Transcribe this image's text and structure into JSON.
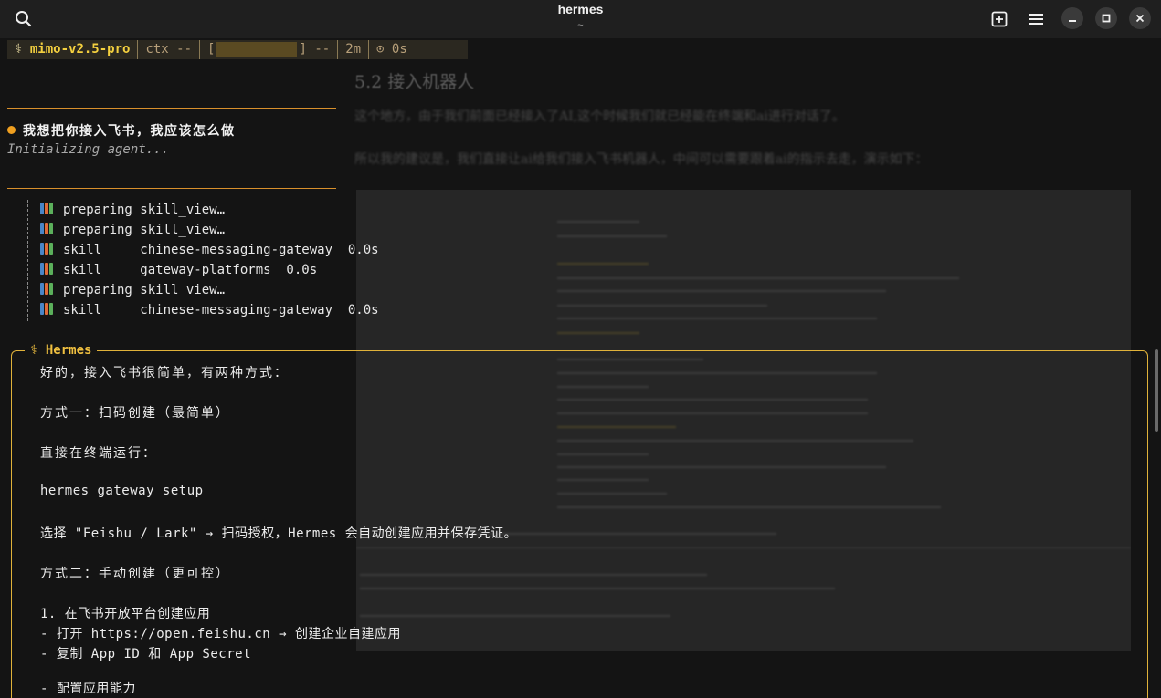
{
  "window": {
    "title": "hermes",
    "subtitle": "~"
  },
  "status": {
    "model_icon": "⚕",
    "model": "mimo-v2.5-pro",
    "ctx": "ctx --",
    "bar_open": "[",
    "bar_close": "] --",
    "time": "2m",
    "timer_icon": "⊙",
    "elapsed": "0s"
  },
  "background_document": {
    "heading": "5.2 接入机器人",
    "paragraph_1": "这个地方，由于我们前面已经接入了AI,这个时候我们就已经能在终端和ai进行对话了。",
    "paragraph_2": "所以我的建议是，我们直接让ai给我们接入飞书机器人，中间可以需要跟着ai的指示去走，演示如下："
  },
  "conversation": {
    "user_message": "我想把你接入飞书，我应该怎么做",
    "status_text": "Initializing agent...",
    "tool_calls": [
      {
        "icon": "book-icon",
        "text": "preparing skill_view…"
      },
      {
        "icon": "book-icon",
        "text": "preparing skill_view…"
      },
      {
        "icon": "book-icon",
        "text": "skill     chinese-messaging-gateway  0.0s"
      },
      {
        "icon": "book-icon",
        "text": "skill     gateway-platforms  0.0s"
      },
      {
        "icon": "book-icon",
        "text": "preparing skill_view…"
      },
      {
        "icon": "book-icon",
        "text": "skill     chinese-messaging-gateway  0.0s"
      }
    ]
  },
  "response": {
    "label_icon": "⚕",
    "label": "Hermes",
    "lines": [
      "好的，接入飞书很简单，有两种方式：",
      "方式一：扫码创建（最简单）",
      "直接在终端运行：",
      "hermes gateway setup",
      "选择 \"Feishu / Lark\" → 扫码授权，Hermes 会自动创建应用并保存凭证。",
      "方式二：手动创建（更可控）",
      "1. 在飞书开放平台创建应用",
      "- 打开 https://open.feishu.cn → 创建企业自建应用",
      "- 复制 App ID 和 App Secret",
      "- 配置应用能力"
    ]
  },
  "colors": {
    "accent": "#f4d03f",
    "separator": "#d8902c",
    "box_border": "#e0b23a",
    "background": "#141414"
  }
}
